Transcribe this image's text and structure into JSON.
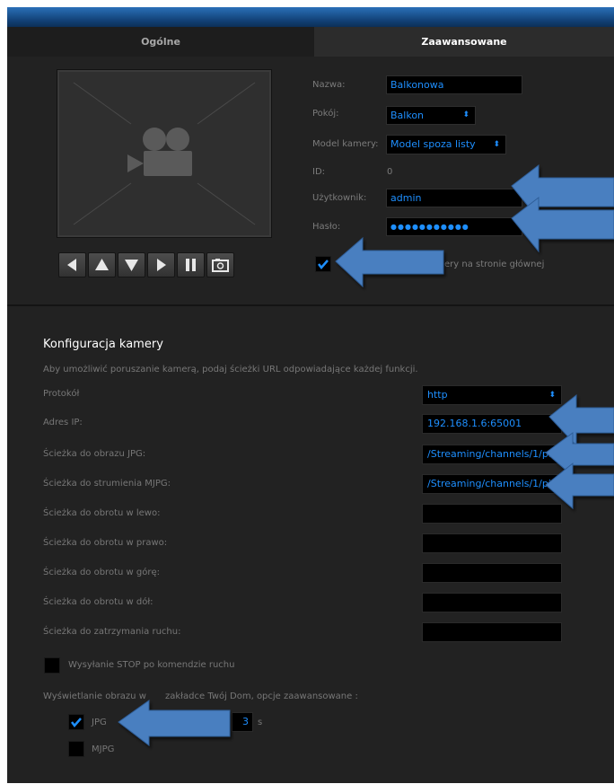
{
  "tabs": [
    {
      "label": "Ogólne"
    },
    {
      "label": "Zaawansowane"
    }
  ],
  "camera_form": {
    "name_label": "Nazwa:",
    "name_value": "Balkonowa",
    "room_label": "Pokój:",
    "room_value": "Balkon",
    "model_label": "Model kamery:",
    "model_value": "Model spoza listy",
    "id_label": "ID:",
    "id_value": "0",
    "user_label": "Użytkownik:",
    "user_value": "admin",
    "password_label": "Hasło:",
    "password_value": "●●●●●●●●●●●",
    "show_on_home_label": "ery na stronie głównej",
    "show_on_home_checked": true
  },
  "preview": {
    "icon": "video-camera-icon"
  },
  "controls": [
    {
      "icon": "arrow-left-icon"
    },
    {
      "icon": "arrow-up-icon"
    },
    {
      "icon": "arrow-down-icon"
    },
    {
      "icon": "arrow-right-icon"
    },
    {
      "icon": "pause-icon"
    },
    {
      "icon": "camera-snapshot-icon"
    }
  ],
  "config": {
    "title": "Konfiguracja kamery",
    "description": "Aby umożliwić poruszanie kamerą, podaj ścieżki URL odpowiadające każdej funkcji.",
    "protocol_label": "Protokół",
    "protocol_value": "http",
    "ip_label": "Adres IP:",
    "ip_value": "192.168.1.6:65001",
    "jpg_path_label": "Ścieżka do obrazu JPG:",
    "jpg_path_value": "/Streaming/channels/1/prev",
    "mjpg_path_label": "Ścieżka do strumienia MJPG:",
    "mjpg_path_value": "/Streaming/channels/1/pictu",
    "left_label": "Ścieżka do obrotu w lewo:",
    "left_value": "",
    "right_label": "Ścieżka do obrotu w prawo:",
    "right_value": "",
    "up_label": "Ścieżka do obrotu w górę:",
    "up_value": "",
    "down_label": "Ścieżka do obrotu w dół:",
    "down_value": "",
    "stop_label": "Ścieżka do zatrzymania ruchu:",
    "stop_value": "",
    "send_stop_label": "Wysyłanie STOP po komendzie ruchu",
    "send_stop_checked": false,
    "display_label_a": "Wyświetlanie obrazu w",
    "display_label_b": "zakładce Twój Dom, opcje zaawansowane :",
    "jpg_label": "JPG",
    "jpg_checked": true,
    "interval_value": "3",
    "interval_unit": "s",
    "mjpg_label": "MJPG",
    "mjpg_checked": false
  },
  "colors": {
    "accent": "#1e8fff",
    "annotation_arrow": "#4a7fc0",
    "background": "#222222"
  }
}
